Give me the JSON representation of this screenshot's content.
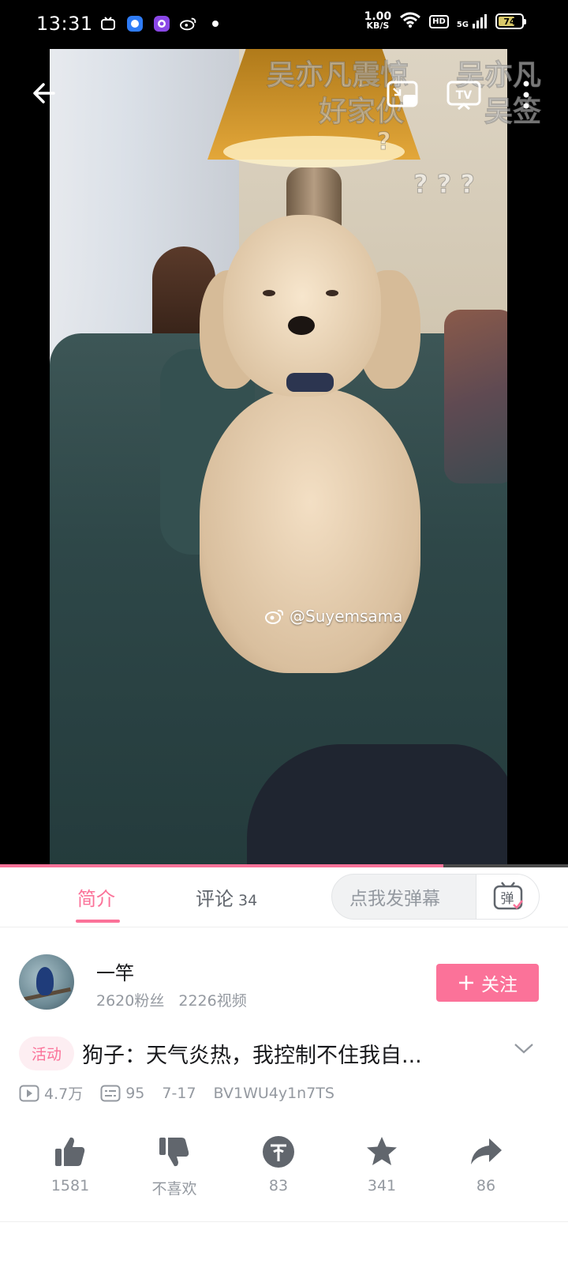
{
  "status_bar": {
    "time": "13:31",
    "net_speed_value": "1.00",
    "net_speed_unit": "KB/S",
    "hd_label": "HD",
    "signal_label": "5G",
    "battery": "74",
    "battery_level": 0.74,
    "battery_color": "#d8c86a"
  },
  "video": {
    "danmaku": [
      "吴亦凡震惊",
      "好家伙",
      "吴亦凡",
      "吴签",
      "?",
      "? ? ?"
    ],
    "watermark": "@Suyemsama",
    "progress": 0.78
  },
  "tabs": {
    "intro_label": "简介",
    "comments_label": "评论",
    "comments_count": "34",
    "danmaku_placeholder": "点我发弹幕",
    "danmaku_button_label": "弹"
  },
  "uploader": {
    "name": "一竿",
    "fans": "2620粉丝",
    "videos": "2226视频",
    "follow_label": "关注"
  },
  "video_info": {
    "tag": "活动",
    "title": "狗子：天气炎热，我控制不住我自...",
    "views": "4.7万",
    "danmaku_count": "95",
    "date": "7-17",
    "bvid": "BV1WU4y1n7TS"
  },
  "actions": {
    "like": "1581",
    "dislike": "不喜欢",
    "coin": "83",
    "favorite": "341",
    "share": "86"
  },
  "colors": {
    "accent": "#fb7299",
    "icon_gray": "#61666d",
    "text_secondary": "#9499a0"
  }
}
